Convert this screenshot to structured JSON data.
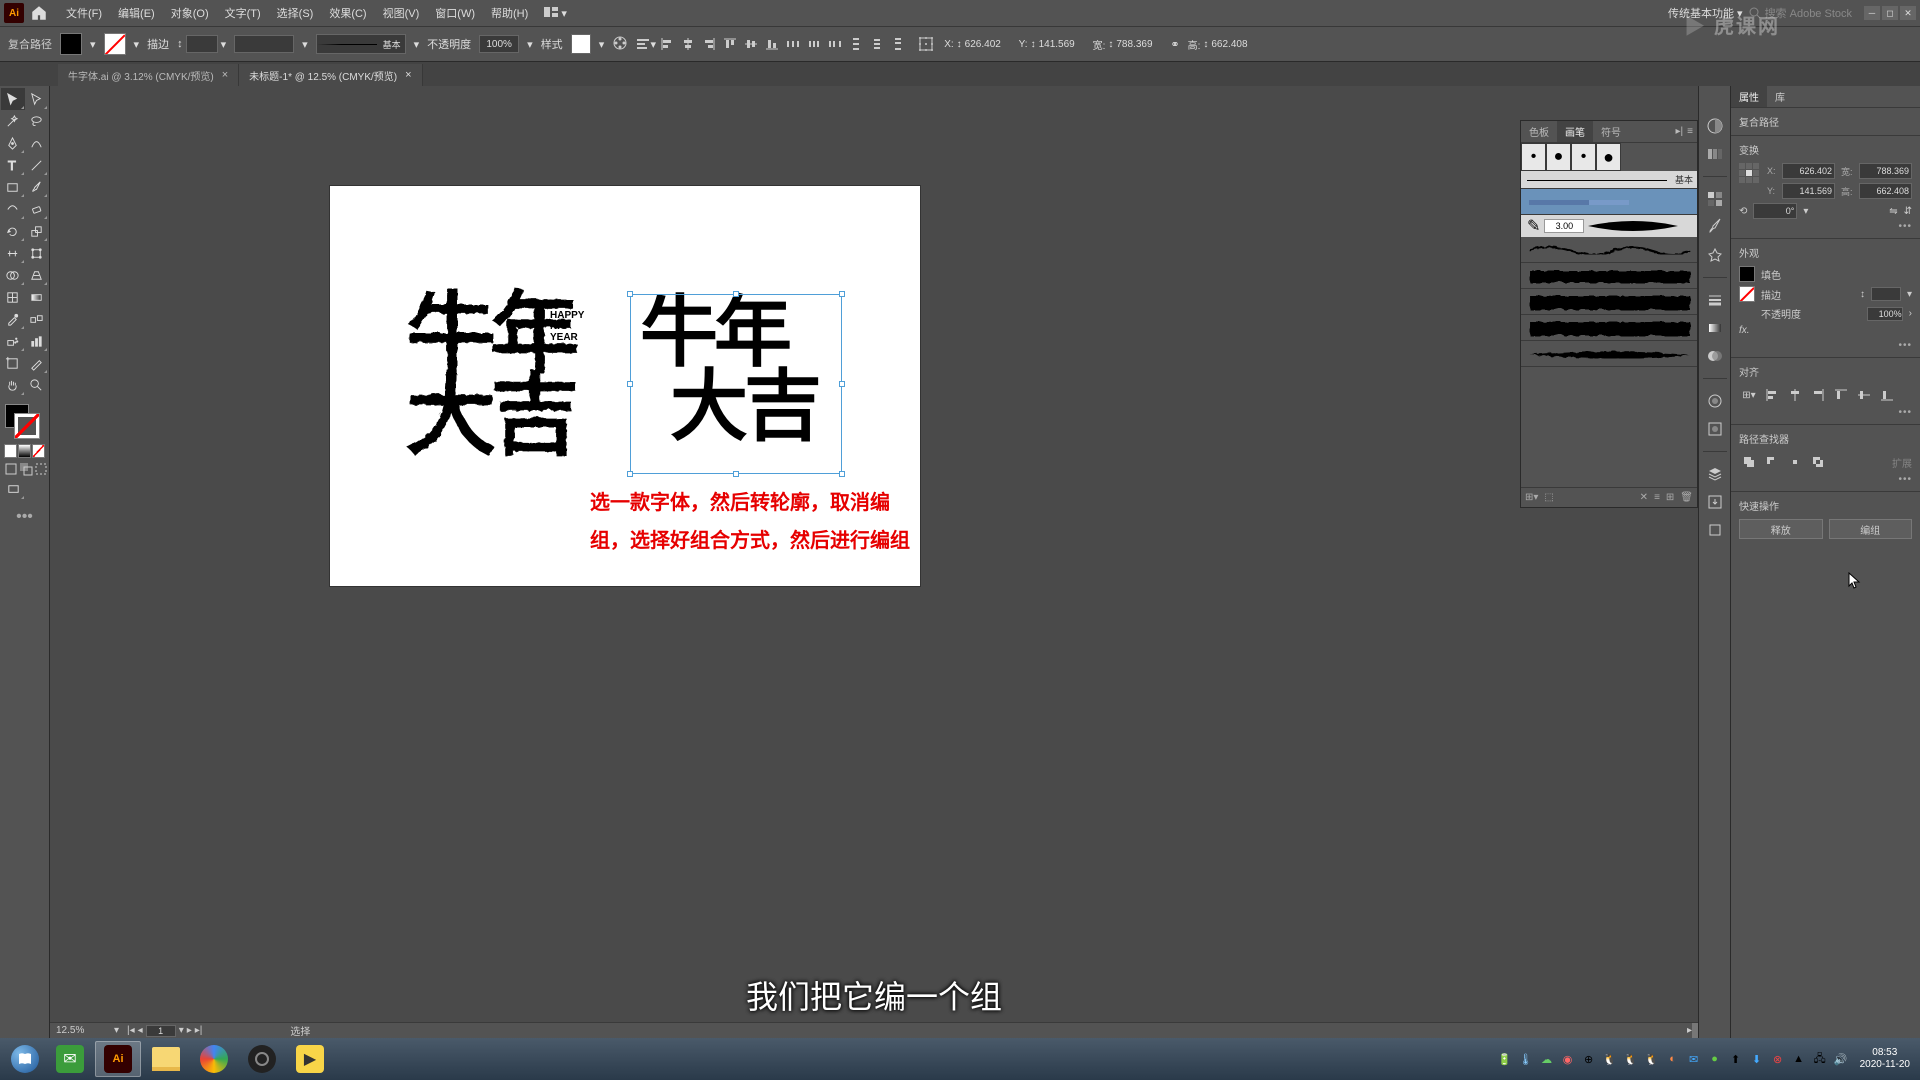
{
  "menu": {
    "file": "文件(F)",
    "edit": "编辑(E)",
    "object": "对象(O)",
    "type": "文字(T)",
    "select": "选择(S)",
    "effect": "效果(C)",
    "view": "视图(V)",
    "window": "窗口(W)",
    "help": "帮助(H)"
  },
  "workspace": "传统基本功能",
  "search_placeholder": "搜索 Adobe Stock",
  "control": {
    "selection_label": "复合路径",
    "stroke_label": "描边",
    "stroke_value": "",
    "brush_label": "基本",
    "opacity_label": "不透明度",
    "opacity_value": "100%",
    "style_label": "样式",
    "x_label": "X:",
    "x_value": "626.402",
    "y_label": "Y:",
    "y_value": "141.569",
    "w_label": "宽:",
    "w_value": "788.369",
    "h_label": "高:",
    "h_value": "662.408"
  },
  "tabs": [
    {
      "label": "牛字体.ai @ 3.12% (CMYK/预览)"
    },
    {
      "label": "未标题-1* @ 12.5% (CMYK/预览)"
    }
  ],
  "artboard": {
    "happy": {
      "l1": "HAPPY",
      "l2": "NIU",
      "l3": "YEAR"
    },
    "chars_left_1": "牛年",
    "chars_left_2": "大吉",
    "chars_right_1": "牛年",
    "chars_right_2": "大吉",
    "instruction": "选一款字体，然后转轮廓，取消编组，选择好组合方式，然后进行编组"
  },
  "subtitle": "我们把它编一个组",
  "brushes": {
    "tab_swatch": "色板",
    "tab_brush": "画笔",
    "tab_symbol": "符号",
    "basic": "基本",
    "size_value": "3.00"
  },
  "props": {
    "tab_props": "属性",
    "tab_lib": "库",
    "selection": "复合路径",
    "transform_title": "变换",
    "x_label": "X:",
    "x_val": "626.402",
    "y_label": "Y:",
    "y_val": "141.569",
    "w_label": "宽:",
    "w_val": "788.369",
    "h_label": "高:",
    "h_val": "662.408",
    "rotate_val": "0°",
    "appearance_title": "外观",
    "fill_label": "填色",
    "stroke_label": "描边",
    "opacity_label": "不透明度",
    "opacity_val": "100%",
    "align_title": "对齐",
    "pathfinder_title": "路径查找器",
    "quick_title": "快速操作",
    "btn_release": "释放",
    "btn_edit": "编组"
  },
  "status": {
    "zoom": "12.5%",
    "artboard_num": "1",
    "mode": "选择"
  },
  "clock": {
    "time": "08:53",
    "date": "2020-11-20"
  },
  "watermark": "虎课网"
}
